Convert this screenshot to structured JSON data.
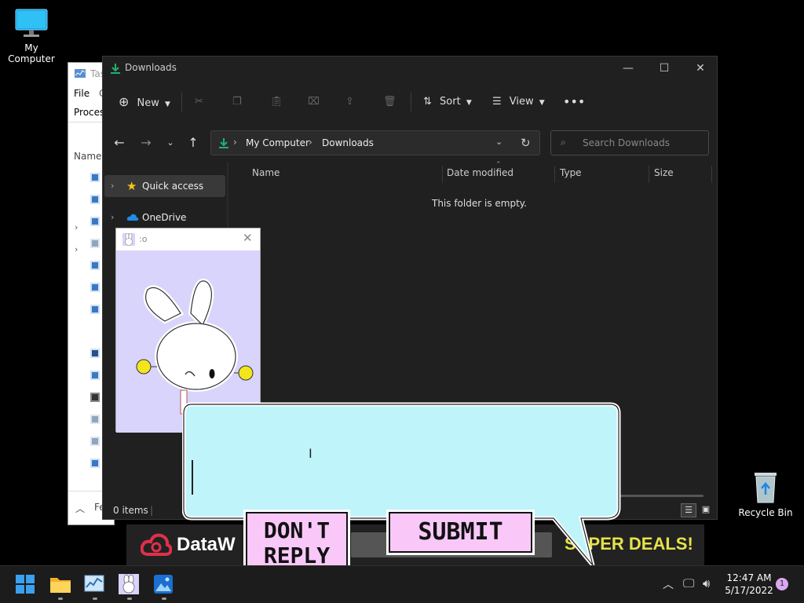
{
  "desktop": {
    "icons": [
      {
        "label": "My Computer",
        "icon": "monitor-icon"
      },
      {
        "label": "Recycle Bin",
        "icon": "recycle-bin-icon"
      }
    ]
  },
  "task_manager": {
    "title": "Tas",
    "menu_file": "File",
    "menu_c": "C",
    "tab_processes": "Proces",
    "col_name": "Name",
    "footer": "Fe"
  },
  "explorer": {
    "title": "Downloads",
    "toolbar": {
      "new_label": "New",
      "sort_label": "Sort",
      "view_label": "View"
    },
    "address": {
      "root": "My Computer",
      "current": "Downloads"
    },
    "search_placeholder": "Search Downloads",
    "nav": [
      {
        "label": "Quick access",
        "icon": "star-icon"
      },
      {
        "label": "OneDrive",
        "icon": "cloud-icon"
      }
    ],
    "columns": [
      "Name",
      "Date modified",
      "Type",
      "Size"
    ],
    "empty_message": "This folder is empty.",
    "status_items": "0 items"
  },
  "popup": {
    "title": ":o"
  },
  "chat": {
    "dont_reply_line1": "DON'T",
    "dont_reply_line2": "REPLY",
    "submit_label": "SUBMIT"
  },
  "ad": {
    "brand": "DataW",
    "tagline": "SUPER DEALS!"
  },
  "taskbar": {
    "time": "12:47 AM",
    "date": "5/17/2022",
    "notification_count": "1"
  },
  "colors": {
    "accent_green": "#20b070",
    "bubble_cyan": "#bff4fb",
    "button_pink": "#f9c8f9",
    "ad_yellow": "#e6e24a",
    "ad_red": "#e0304a"
  }
}
